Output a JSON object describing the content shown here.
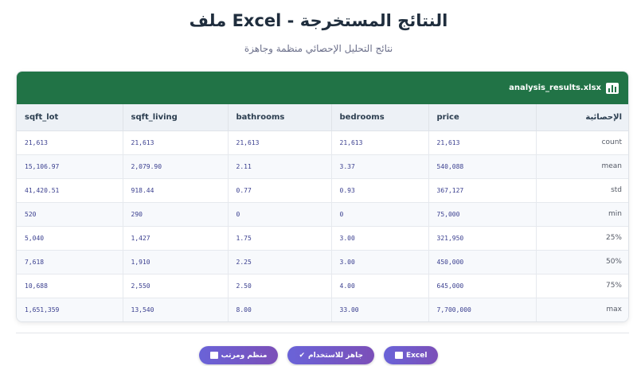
{
  "header": {
    "title": "ملف Excel - النتائج المستخرجة",
    "subtitle": "نتائج التحليل الإحصائي منظمة وجاهزة"
  },
  "card": {
    "file_name": "analysis_results.xlsx",
    "icon": "bar-chart-icon",
    "header_color": "#217346"
  },
  "table": {
    "columns": [
      "الإحصائية",
      "price",
      "bedrooms",
      "bathrooms",
      "sqft_living",
      "sqft_lot"
    ],
    "rows": [
      [
        "count",
        "21,613",
        "21,613",
        "21,613",
        "21,613",
        "21,613"
      ],
      [
        "mean",
        "540,088",
        "3.37",
        "2.11",
        "2,079.90",
        "15,106.97"
      ],
      [
        "std",
        "367,127",
        "0.93",
        "0.77",
        "918.44",
        "41,420.51"
      ],
      [
        "min",
        "75,000",
        "0",
        "0",
        "290",
        "520"
      ],
      [
        "25%",
        "321,950",
        "3.00",
        "1.75",
        "1,427",
        "5,040"
      ],
      [
        "50%",
        "450,000",
        "3.00",
        "2.25",
        "1,910",
        "7,618"
      ],
      [
        "75%",
        "645,000",
        "4.00",
        "2.50",
        "2,550",
        "10,688"
      ],
      [
        "max",
        "7,700,000",
        "33.00",
        "8.00",
        "13,540",
        "1,651,359"
      ]
    ]
  },
  "buttons": [
    {
      "label": "Excel",
      "icon": "bar-chart-icon"
    },
    {
      "label": "جاهز للاستخدام",
      "icon": "check-icon"
    },
    {
      "label": "منظم ومرتب",
      "icon": "bar-chart-icon"
    }
  ],
  "colors": {
    "accent": "#6a63d8",
    "excel_green": "#217346"
  }
}
